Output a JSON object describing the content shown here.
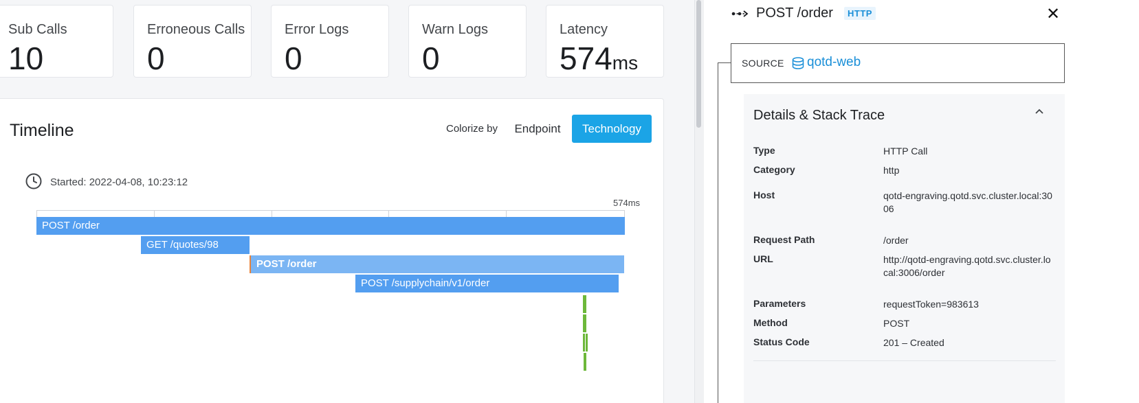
{
  "stats": {
    "sub_calls": {
      "label": "Sub Calls",
      "value": "10"
    },
    "erroneous_calls": {
      "label": "Erroneous Calls",
      "value": "0"
    },
    "error_logs": {
      "label": "Error Logs",
      "value": "0"
    },
    "warn_logs": {
      "label": "Warn Logs",
      "value": "0"
    },
    "latency": {
      "label": "Latency",
      "value": "574",
      "unit": "ms"
    }
  },
  "timeline": {
    "title": "Timeline",
    "colorize_label": "Colorize by",
    "endpoint_button": "Endpoint",
    "technology_button": "Technology",
    "started": "Started: 2022-04-08, 10:23:12",
    "axis_end": "574ms",
    "bars": [
      {
        "label": "POST /order"
      },
      {
        "label": "GET /quotes/98"
      },
      {
        "label": "POST /order"
      },
      {
        "label": "POST /supplychain/v1/order"
      }
    ]
  },
  "panel": {
    "title": "POST /order",
    "badge": "HTTP",
    "close": "✕",
    "source_label": "SOURCE",
    "source_name": "qotd-web",
    "details_title": "Details & Stack Trace",
    "rows": [
      {
        "key": "Type",
        "value": "HTTP Call"
      },
      {
        "key": "Category",
        "value": "http"
      },
      {
        "key": "Host",
        "value": "qotd-engraving.qotd.svc.cluster.local:3006"
      },
      {
        "key": "Request Path",
        "value": "/order"
      },
      {
        "key": "URL",
        "value": "http://qotd-engraving.qotd.svc.cluster.local:3006/order"
      },
      {
        "key": "Parameters",
        "value": "requestToken=983613"
      },
      {
        "key": "Method",
        "value": "POST"
      },
      {
        "key": "Status Code",
        "value": "201 – Created"
      }
    ]
  },
  "colors": {
    "accent": "#1ba4e6",
    "bar": "#539ef0",
    "bar_light": "#7bb5f3",
    "green": "#6db83a",
    "link": "#1a8fd8"
  },
  "icons": {
    "clock": "clock-icon",
    "span": "span-icon",
    "database": "database-icon",
    "close": "close-icon",
    "chevron": "chevron-up-icon"
  }
}
